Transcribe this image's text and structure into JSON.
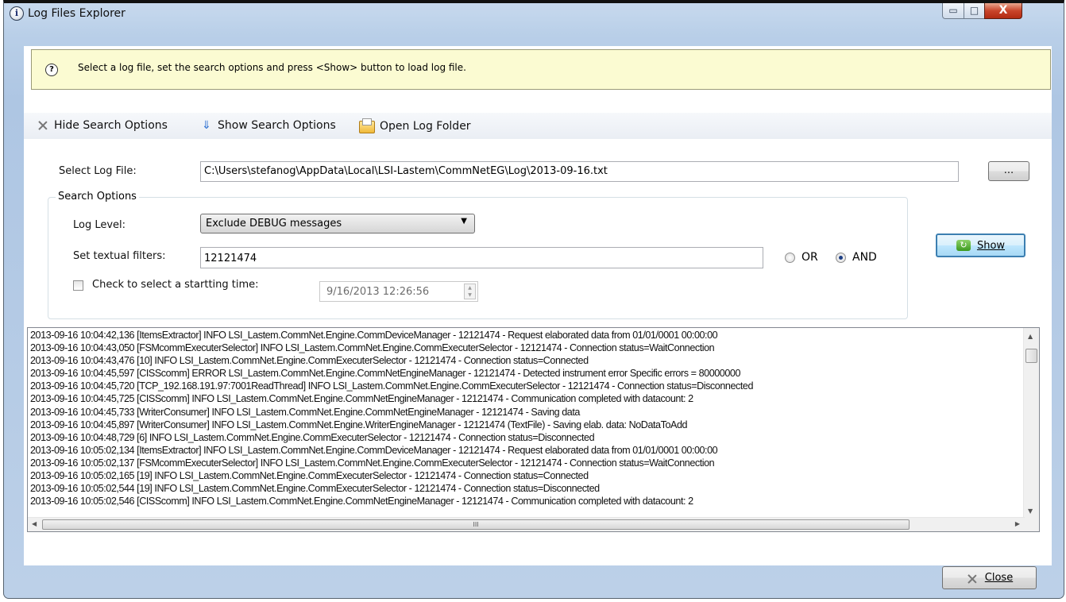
{
  "window": {
    "title": "Log Files Explorer",
    "title_icon": "info-icon",
    "controls": {
      "minimize": "▭",
      "maximize": "□",
      "close": "X"
    }
  },
  "info": {
    "icon": "question-icon",
    "icon_glyph": "?",
    "text": "Select a log file, set the search options and press <Show> button to load log file."
  },
  "toolbar": {
    "hide_label": "Hide Search Options",
    "show_label": "Show Search Options",
    "open_folder_label": "Open Log Folder",
    "down_glyph": "⇓"
  },
  "form": {
    "select_log_label": "Select Log File:",
    "log_file_path": "C:\\Users\\stefanog\\AppData\\Local\\LSI-Lastem\\CommNetEG\\Log\\2013-09-16.txt",
    "browse_label": "...",
    "search_options_title": "Search Options",
    "log_level_label": "Log Level:",
    "log_level_value": "Exclude DEBUG messages",
    "combo_arrow": "▼",
    "text_filter_label": "Set textual filters:",
    "text_filter_value": "12121474",
    "or_label": "OR",
    "and_label": "AND",
    "selected_logic": "AND",
    "start_time_label": "Check to select a startting time:",
    "start_time_checked": false,
    "start_time_value": "9/16/2013 12:26:56",
    "show_label": "Show",
    "show_icon_glyph": "↻"
  },
  "log": {
    "lines": [
      "2013-09-16 10:04:42,136 [ItemsExtractor] INFO  LSI_Lastem.CommNet.Engine.CommDeviceManager - 12121474 - Request elaborated data from 01/01/0001 00:00:00",
      "2013-09-16 10:04:43,050 [FSMcommExecuterSelector] INFO  LSI_Lastem.CommNet.Engine.CommExecuterSelector - 12121474 - Connection status=WaitConnection",
      "2013-09-16 10:04:43,476 [10] INFO  LSI_Lastem.CommNet.Engine.CommExecuterSelector - 12121474 - Connection status=Connected",
      "2013-09-16 10:04:45,597 [CISScomm] ERROR LSI_Lastem.CommNet.Engine.CommNetEngineManager - 12121474 - Detected instrument error Specific errors = 80000000",
      "2013-09-16 10:04:45,720 [TCP_192.168.191.97:7001ReadThread] INFO  LSI_Lastem.CommNet.Engine.CommExecuterSelector - 12121474 - Connection status=Disconnected",
      "2013-09-16 10:04:45,725 [CISScomm] INFO  LSI_Lastem.CommNet.Engine.CommNetEngineManager - 12121474 - Communication completed with datacount: 2",
      "2013-09-16 10:04:45,733 [WriterConsumer] INFO  LSI_Lastem.CommNet.Engine.CommNetEngineManager - 12121474 - Saving data",
      "2013-09-16 10:04:45,897 [WriterConsumer] INFO  LSI_Lastem.CommNet.Engine.WriterEngineManager - 12121474 (TextFile) - Saving elab. data: NoDataToAdd",
      "2013-09-16 10:04:48,729 [6] INFO  LSI_Lastem.CommNet.Engine.CommExecuterSelector - 12121474 - Connection status=Disconnected",
      "2013-09-16 10:05:02,134 [ItemsExtractor] INFO  LSI_Lastem.CommNet.Engine.CommDeviceManager - 12121474 - Request elaborated data from 01/01/0001 00:00:00",
      "2013-09-16 10:05:02,137 [FSMcommExecuterSelector] INFO  LSI_Lastem.CommNet.Engine.CommExecuterSelector - 12121474 - Connection status=WaitConnection",
      "2013-09-16 10:05:02,165 [19] INFO  LSI_Lastem.CommNet.Engine.CommExecuterSelector - 12121474 - Connection status=Connected",
      "2013-09-16 10:05:02,544 [19] INFO  LSI_Lastem.CommNet.Engine.CommExecuterSelector - 12121474 - Connection status=Disconnected",
      "2013-09-16 10:05:02,546 [CISScomm] INFO  LSI_Lastem.CommNet.Engine.CommNetEngineManager - 12121474 - Communication completed with datacount: 2"
    ],
    "hscroll_grip": "III",
    "arrow_up": "▲",
    "arrow_down": "▼",
    "arrow_left": "◀",
    "arrow_right": "▶"
  },
  "footer": {
    "close_label": "Close"
  },
  "colors": {
    "info_bg": "#fbfbd2",
    "accent": "#3c7fb1",
    "close_red": "#c9452a"
  }
}
